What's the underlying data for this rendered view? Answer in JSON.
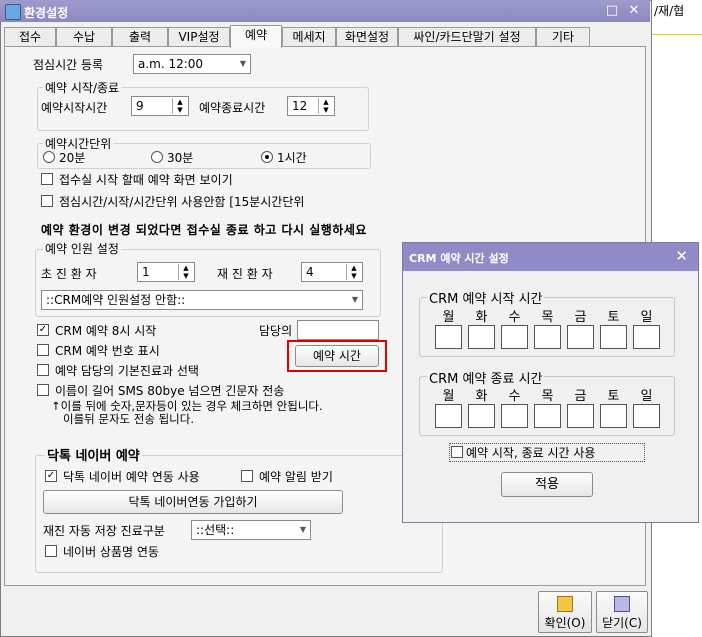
{
  "window": {
    "title": "환경설정"
  },
  "right_strip": {
    "text": "/재/협"
  },
  "tabs": [
    {
      "label": "접수"
    },
    {
      "label": "수납"
    },
    {
      "label": "출력"
    },
    {
      "label": "VIP설정"
    },
    {
      "label": "예약",
      "active": true
    },
    {
      "label": "메세지"
    },
    {
      "label": "화면설정"
    },
    {
      "label": "싸인/카드단말기 설정"
    },
    {
      "label": "기타"
    }
  ],
  "lunch": {
    "label": "점심시간 등록",
    "value": "a.m. 12:00"
  },
  "reservation_time": {
    "group_label": "예약 시작/종료",
    "start_label": "예약시작시간",
    "start_value": "9",
    "end_label": "예약종료시간",
    "end_value": "12"
  },
  "unit": {
    "group_label": "예약시간단위",
    "options": [
      "20분",
      "30분",
      "1시간"
    ],
    "selected": "1시간"
  },
  "checks": {
    "show_on_reception": "접수실 시작 할때 예약 화면 보이기",
    "lunch_unit": "점심시간/시작/시간단위 사용안함 [15분시간단위"
  },
  "notice": "예약 환경이 변경 되었다면 접수실 종료 하고 다시 실행하세요",
  "headcount": {
    "group_label": "예약 인원 설정",
    "first_label": "초 진 환 자",
    "first_value": "1",
    "return_label": "재 진 환 자",
    "return_value": "4",
    "crm_combo": "::CRM예약 인원설정 안함::"
  },
  "crm": {
    "start8": "CRM 예약 8시 시작",
    "show_number": "CRM 예약 번호 표시",
    "default_fee": "예약 담당의 기본진료과 선택",
    "sms_long": "이름이 길어 SMS 80bye 넘으면 긴문자 전송",
    "sms_note1": "↑이를 뒤에 숫자,문자등이 있는 경우 체크하면 안됩니다.",
    "sms_note2": "이를뒤 문자도 전송 됩니다.",
    "doctor_label": "담당의",
    "reserve_time_button": "예약 시간"
  },
  "naver": {
    "title": "닥톡 네이버 예약",
    "link": "닥톡 네이버 예약 연동 사용",
    "notify": "예약 알림 받기",
    "join_button": "닥톡 네이버연동 가입하기",
    "category_label": "재진 자동 저장 진료구분",
    "category_value": "::선택::",
    "product_name": "네이버 상품명 연동"
  },
  "footer": {
    "ok": "확인(O)",
    "close": "닫기(C)"
  },
  "dialog": {
    "title": "CRM 예약 시간 설정",
    "start_label": "CRM 예약 시작 시간",
    "end_label": "CRM 예약 종료 시간",
    "days": [
      "월",
      "화",
      "수",
      "목",
      "금",
      "토",
      "일"
    ],
    "use_label": "예약 시작, 종료 시간 사용",
    "apply": "적용"
  },
  "colors": {
    "titlebar": "#8f8bc6",
    "highlight": "#e00000",
    "accent": "#2d5f8f"
  }
}
